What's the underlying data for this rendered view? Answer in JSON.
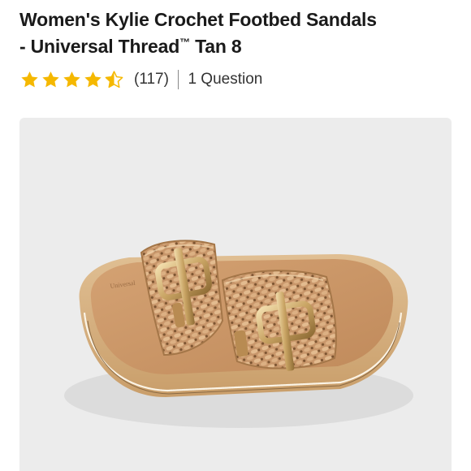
{
  "product": {
    "title_line1": "Women's Kylie Crochet Footbed Sandals",
    "title_line2_prefix": "- Universal Thread",
    "trademark": "™",
    "title_line2_suffix": " Tan 8"
  },
  "rating": {
    "stars": 4.5,
    "count_text": "(117)",
    "questions_text": "1 Question",
    "star_color": "#f5b800"
  },
  "image": {
    "subject": "tan crochet double-buckle footbed slide sandal",
    "background_color": "#ececec"
  }
}
